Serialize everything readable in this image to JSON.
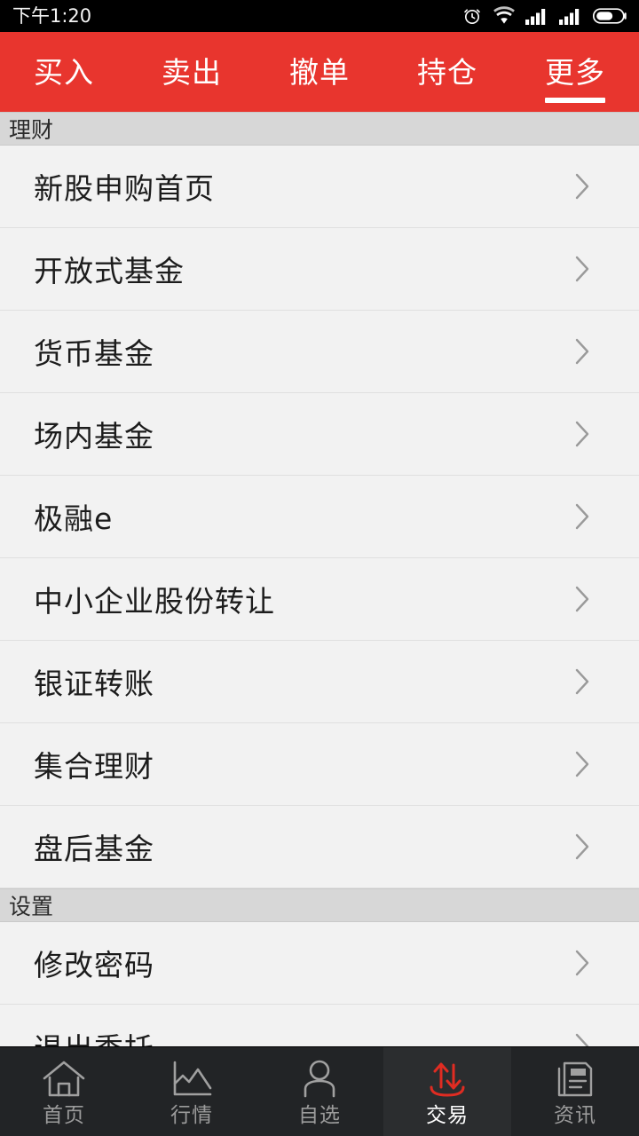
{
  "status_bar": {
    "time": "下午1:20",
    "icons": [
      "alarm-icon",
      "wifi-icon",
      "signal-icon-1",
      "signal-icon-2",
      "battery-icon"
    ]
  },
  "top_tabs": {
    "items": [
      {
        "label": "买入",
        "active": false
      },
      {
        "label": "卖出",
        "active": false
      },
      {
        "label": "撤单",
        "active": false
      },
      {
        "label": "持仓",
        "active": false
      },
      {
        "label": "更多",
        "active": true
      }
    ]
  },
  "sections": [
    {
      "header": "理财",
      "items": [
        {
          "label": "新股申购首页"
        },
        {
          "label": "开放式基金"
        },
        {
          "label": "货币基金"
        },
        {
          "label": "场内基金"
        },
        {
          "label": "极融e"
        },
        {
          "label": "中小企业股份转让"
        },
        {
          "label": "银证转账"
        },
        {
          "label": "集合理财"
        },
        {
          "label": "盘后基金"
        }
      ]
    },
    {
      "header": "设置",
      "items": [
        {
          "label": "修改密码"
        },
        {
          "label": "退出委托"
        }
      ]
    }
  ],
  "bottom_nav": {
    "items": [
      {
        "label": "首页",
        "icon": "home-icon",
        "active": false
      },
      {
        "label": "行情",
        "icon": "chart-icon",
        "active": false
      },
      {
        "label": "自选",
        "icon": "person-icon",
        "active": false
      },
      {
        "label": "交易",
        "icon": "trade-arrows-icon",
        "active": true
      },
      {
        "label": "资讯",
        "icon": "news-icon",
        "active": false
      }
    ]
  },
  "colors": {
    "accent_red": "#e8352e",
    "trade_icon_red": "#e02c22",
    "nav_bg": "#222426",
    "list_bg": "#f2f2f2",
    "section_header_bg": "#d7d7d7"
  }
}
